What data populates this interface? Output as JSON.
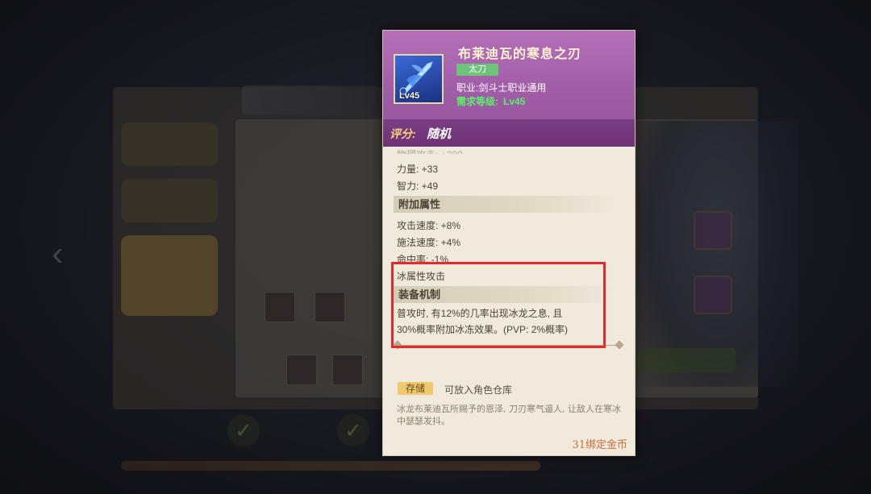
{
  "item": {
    "name": "布莱迪瓦的寒息之刃",
    "type_badge": "太刀",
    "class_line": "职业:剑斗士职业通用",
    "req_label": "需求等级:",
    "req_value": "Lv45",
    "icon_level": "Lv45",
    "icon": "ice-sword-icon"
  },
  "rating": {
    "label": "评分:",
    "value": "随机"
  },
  "base_stats": [
    {
      "text": "力量: +33"
    },
    {
      "text": "智力: +49"
    }
  ],
  "bonus_section": {
    "title": "附加属性",
    "stats": [
      {
        "text": "攻击速度: +8%"
      },
      {
        "text": "施法速度: +4%"
      },
      {
        "text": "命中率: -1%"
      }
    ],
    "element": "冰属性攻击"
  },
  "mechanism": {
    "title": "装备机制",
    "line1": "普攻时, 有12%的几率出现冰龙之息, 且",
    "line2": "30%概率附加冰冻效果。(PVP: 2%概率)"
  },
  "storage": {
    "badge": "存储",
    "text": "可放入角色仓库"
  },
  "flavor_text": "冰龙布莱迪瓦所赐予的恩泽, 刀刃寒气逼人, 让敌人在寒冰中瑟瑟发抖。",
  "price": "31绑定金币",
  "colors": {
    "header": "#a35fa9",
    "rating_bar": "#763a7e",
    "req_green": "#5cf06a",
    "highlight": "#e8282c",
    "price": "#cf6a3a"
  }
}
